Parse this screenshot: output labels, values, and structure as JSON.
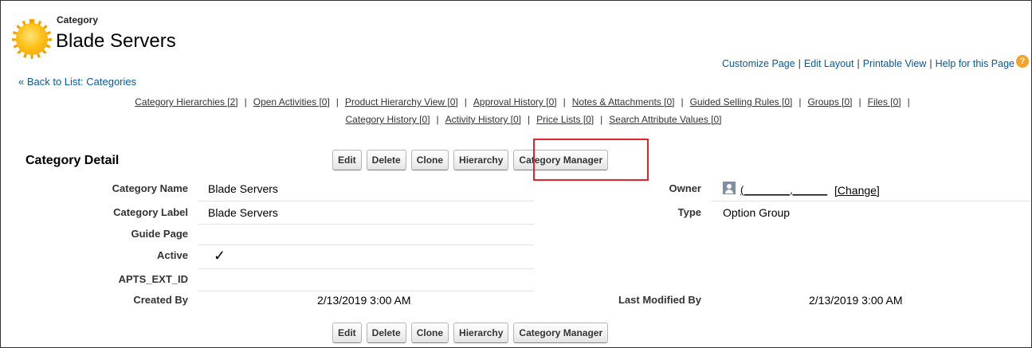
{
  "header": {
    "object_type": "Category",
    "title": "Blade Servers"
  },
  "top_links": [
    "Customize Page",
    "Edit Layout",
    "Printable View",
    "Help for this Page"
  ],
  "back_link": "« Back to List: Categories",
  "related_lists": {
    "row1": [
      "Category Hierarchies [2]",
      "Open Activities [0]",
      "Product Hierarchy View [0]",
      "Approval History [0]",
      "Notes & Attachments [0]",
      "Guided Selling Rules [0]",
      "Groups [0]",
      "Files [0]"
    ],
    "row2": [
      "Category History [0]",
      "Activity History [0]",
      "Price Lists [0]",
      "Search Attribute Values [0]"
    ]
  },
  "detail": {
    "section_title": "Category Detail",
    "buttons": [
      "Edit",
      "Delete",
      "Clone",
      "Hierarchy",
      "Category Manager"
    ],
    "fields": {
      "category_name_label": "Category Name",
      "category_name_value": "Blade Servers",
      "category_label_label": "Category Label",
      "category_label_value": "Blade Servers",
      "guide_page_label": "Guide Page",
      "active_label": "Active",
      "active_value": "✓",
      "ext_id_label": "APTS_EXT_ID",
      "created_by_label": "Created By",
      "created_by_value": "2/13/2019 3:00 AM",
      "owner_label": "Owner",
      "owner_value": "(________,______",
      "owner_change": "[Change]",
      "type_label": "Type",
      "type_value": "Option Group",
      "last_modified_label": "Last Modified By",
      "last_modified_value": "2/13/2019 3:00 AM"
    }
  },
  "colors": {
    "link": "#015ba7",
    "highlight": "#e3232b"
  }
}
